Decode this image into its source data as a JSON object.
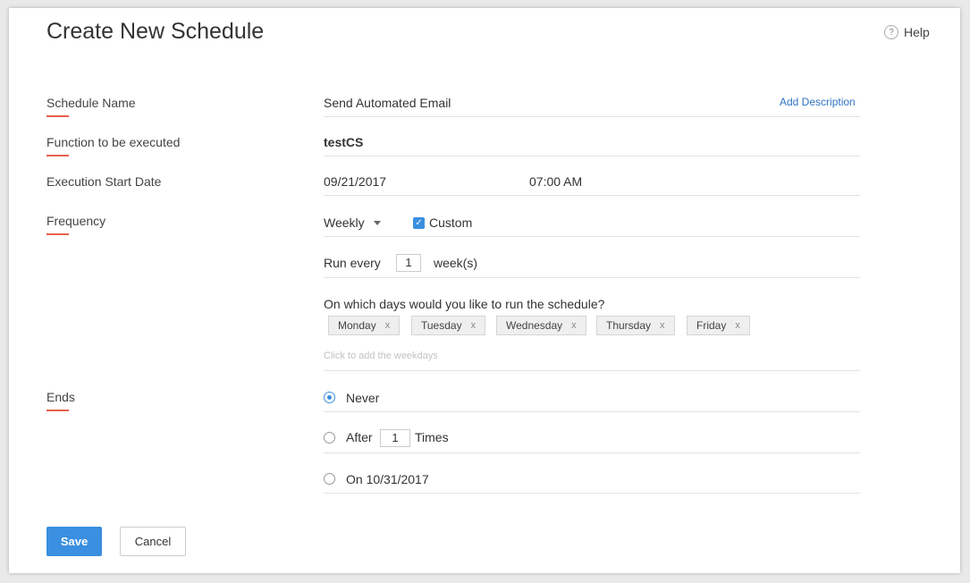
{
  "header": {
    "title": "Create New Schedule",
    "help_label": "Help",
    "help_icon": "?"
  },
  "fields": {
    "schedule_name": {
      "label": "Schedule Name",
      "value": "Send Automated Email",
      "add_description": "Add Description"
    },
    "function": {
      "label": "Function to be executed",
      "value": "testCS"
    },
    "start_date": {
      "label": "Execution Start Date",
      "date": "09/21/2017",
      "time": "07:00 AM"
    },
    "frequency": {
      "label": "Frequency",
      "value": "Weekly",
      "custom_label": "Custom",
      "custom_checked": true
    },
    "run_every": {
      "prefix": "Run every",
      "value": "1",
      "suffix": "week(s)"
    },
    "days": {
      "question": "On which days would you like to run the schedule?",
      "tags": [
        "Monday",
        "Tuesday",
        "Wednesday",
        "Thursday",
        "Friday"
      ],
      "remove_glyph": "x",
      "hint": "Click to add the weekdays"
    },
    "ends": {
      "label": "Ends",
      "never": "Never",
      "after_prefix": "After",
      "after_value": "1",
      "after_suffix": "Times",
      "on_date": "On 10/31/2017",
      "selected": "never"
    }
  },
  "actions": {
    "save": "Save",
    "cancel": "Cancel"
  },
  "colors": {
    "accent": "#3a8fe0",
    "label_underline": "#e8604c",
    "link": "#2f73c3"
  }
}
